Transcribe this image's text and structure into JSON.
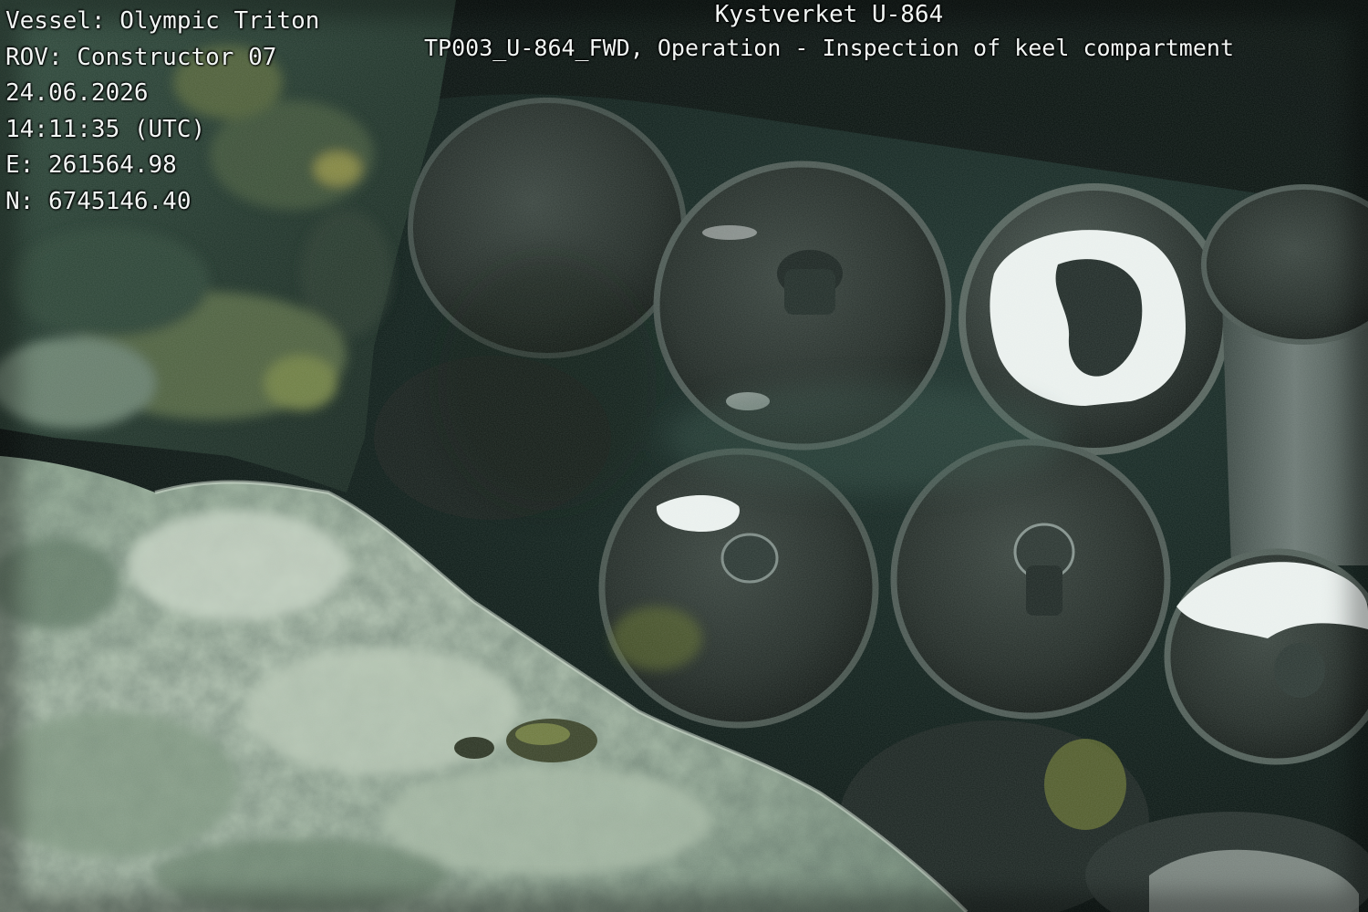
{
  "overlay": {
    "vessel": "Vessel: Olympic Triton",
    "rov": "ROV: Constructor 07",
    "date": "24.06.2026",
    "time": "14:11:35 (UTC)",
    "easting": "E: 261564.98",
    "northing": "N: 6745146.40",
    "title": "Kystverket U-864",
    "subtitle": "TP003_U-864_FWD, Operation - Inspection of keel compartment"
  },
  "scene": {
    "colors": {
      "water": "#0a1613",
      "water_highlight": "#234039",
      "sediment": "#a9bba9",
      "sediment_shadow": "#56705e",
      "canister_dark": "#1c2421",
      "canister_rim": "#48544e",
      "white_deposit": "#eef3f1",
      "algae": "#6f7a2c",
      "text": "#f2f6f4"
    }
  }
}
